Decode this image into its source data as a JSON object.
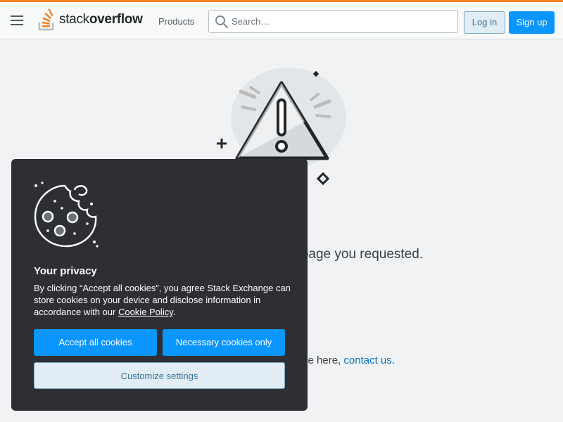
{
  "header": {
    "logo_prefix": "stack",
    "logo_suffix": "overflow",
    "products_label": "Products",
    "search_placeholder": "Search…",
    "login_label": "Log in",
    "signup_label": "Sign up"
  },
  "page": {
    "message_partial": "e page you requested.",
    "contact_prefix": "uld be here, ",
    "contact_link": "contact us",
    "contact_suffix": "."
  },
  "cookie_modal": {
    "title": "Your privacy",
    "text_before_link": "By clicking “Accept all cookies”, you agree Stack Exchange can store cookies on your device and disclose information in accordance with our ",
    "policy_link": "Cookie Policy",
    "text_after_link": ".",
    "accept_all_label": "Accept all cookies",
    "necessary_only_label": "Necessary cookies only",
    "customize_label": "Customize settings"
  },
  "colors": {
    "accent_orange": "#f48225",
    "primary_blue": "#0a95ff",
    "link_blue": "#0074cc",
    "modal_bg": "#2d2f33"
  }
}
